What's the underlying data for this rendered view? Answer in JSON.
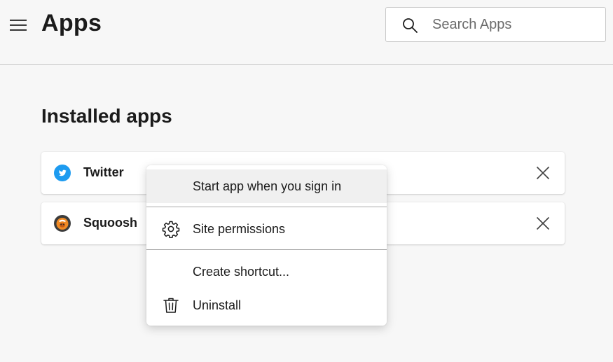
{
  "header": {
    "title": "Apps",
    "menu_icon": "hamburger-menu-icon",
    "search": {
      "placeholder": "Search Apps",
      "value": "",
      "icon": "search-icon"
    }
  },
  "installed": {
    "title": "Installed apps",
    "apps": [
      {
        "name": "Twitter",
        "icon": "twitter-icon",
        "icon_color": "#1d9bf0",
        "remove_icon": "close-icon"
      },
      {
        "name": "Squoosh",
        "icon": "squoosh-icon",
        "icon_color": "#f08a24",
        "remove_icon": "close-icon"
      }
    ]
  },
  "context_menu": {
    "items": [
      {
        "label": "Start app when you sign in",
        "icon": ""
      },
      {
        "label": "Site permissions",
        "icon": "gear-icon"
      },
      {
        "label": "Create shortcut...",
        "icon": ""
      },
      {
        "label": "Uninstall",
        "icon": "trash-icon"
      }
    ]
  },
  "colors": {
    "background": "#f7f7f7",
    "card": "#ffffff",
    "menu_hover": "#f0f0f0",
    "text": "#1b1b1b",
    "placeholder": "#6b6b6b"
  }
}
